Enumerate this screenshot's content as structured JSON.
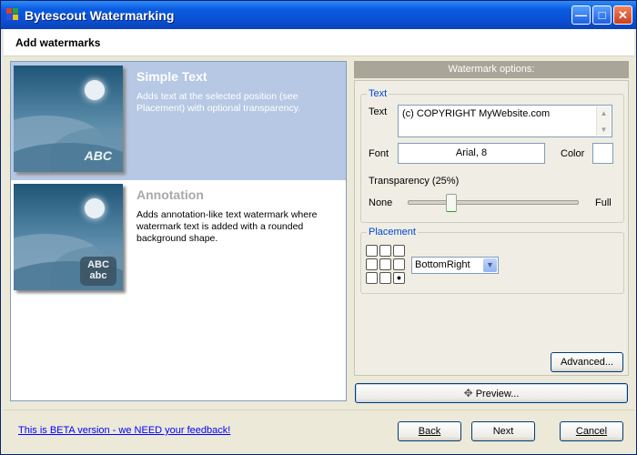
{
  "window": {
    "title": "Bytescout Watermarking"
  },
  "header": {
    "title": "Add watermarks"
  },
  "options": [
    {
      "title": "Simple Text",
      "description": "Adds text at the selected position (see Placement) with optional transparency.",
      "thumb_text": "ABC",
      "selected": true
    },
    {
      "title": "Annotation",
      "description": "Adds annotation-like text watermark where watermark text is added with a rounded background shape.",
      "thumb_text_1": "ABC",
      "thumb_text_2": "abc",
      "selected": false
    }
  ],
  "watermark_options": {
    "title": "Watermark options:",
    "text_group": {
      "legend": "Text",
      "text_label": "Text",
      "text_value": "(c) COPYRIGHT MyWebsite.com",
      "font_label": "Font",
      "font_value": "Arial, 8",
      "color_label": "Color",
      "color_value": "#ffffff",
      "transparency_label": "Transparency (25%)",
      "transparency_percent": 25,
      "none_label": "None",
      "full_label": "Full"
    },
    "placement_group": {
      "legend": "Placement",
      "selected_value": "BottomRight"
    },
    "advanced_button": "Advanced...",
    "preview_button": "Preview..."
  },
  "footer": {
    "feedback_link": "This is BETA version - we NEED your feedback!",
    "back_button": "Back",
    "next_button": "Next",
    "cancel_button": "Cancel"
  }
}
